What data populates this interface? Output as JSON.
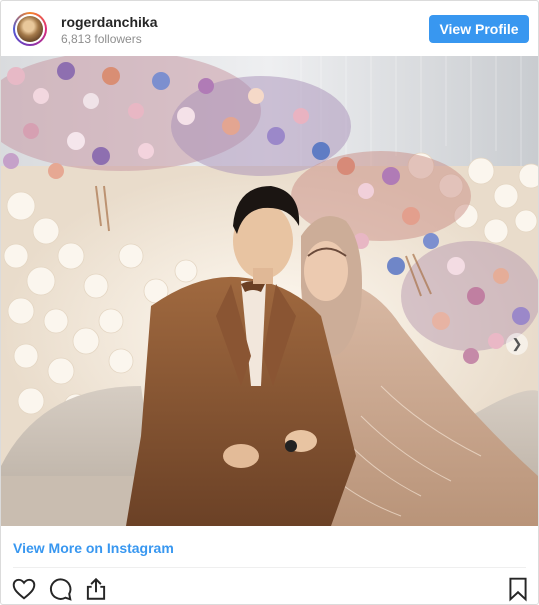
{
  "header": {
    "username": "rogerdanchika",
    "followers": "6,813 followers",
    "view_profile_label": "View Profile"
  },
  "post": {
    "view_more_label": "View More on Instagram"
  },
  "icons": {
    "avatar": "profile-avatar",
    "like": "heart-icon",
    "comment": "comment-icon",
    "share": "share-icon",
    "save": "bookmark-icon",
    "next": "chevron-right-icon"
  },
  "colors": {
    "accent": "#3897f0",
    "text": "#262626",
    "muted": "#8e8e8e"
  }
}
